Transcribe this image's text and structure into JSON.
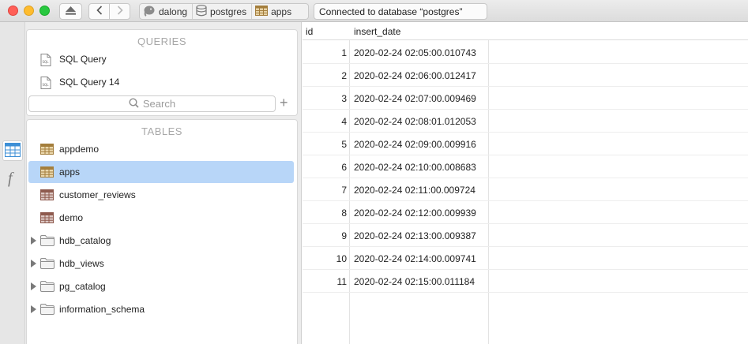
{
  "toolbar": {
    "breadcrumbs": [
      "dalong",
      "postgres",
      "apps"
    ],
    "status": "Connected to database “postgres”"
  },
  "sidebar": {
    "queries_title": "QUERIES",
    "queries": [
      {
        "label": "SQL Query"
      },
      {
        "label": "SQL Query 14"
      }
    ],
    "search_placeholder": "Search",
    "tables_title": "TABLES",
    "tables": [
      {
        "label": "appdemo",
        "kind": "table"
      },
      {
        "label": "apps",
        "kind": "table",
        "selected": true
      },
      {
        "label": "customer_reviews",
        "kind": "table"
      },
      {
        "label": "demo",
        "kind": "table"
      },
      {
        "label": "hdb_catalog",
        "kind": "schema"
      },
      {
        "label": "hdb_views",
        "kind": "schema"
      },
      {
        "label": "pg_catalog",
        "kind": "schema"
      },
      {
        "label": "information_schema",
        "kind": "schema"
      }
    ]
  },
  "grid": {
    "columns": [
      "id",
      "insert_date"
    ],
    "rows": [
      {
        "id": "1",
        "insert_date": "2020-02-24 02:05:00.010743"
      },
      {
        "id": "2",
        "insert_date": "2020-02-24 02:06:00.012417"
      },
      {
        "id": "3",
        "insert_date": "2020-02-24 02:07:00.009469"
      },
      {
        "id": "4",
        "insert_date": "2020-02-24 02:08:01.012053"
      },
      {
        "id": "5",
        "insert_date": "2020-02-24 02:09:00.009916"
      },
      {
        "id": "6",
        "insert_date": "2020-02-24 02:10:00.008683"
      },
      {
        "id": "7",
        "insert_date": "2020-02-24 02:11:00.009724"
      },
      {
        "id": "8",
        "insert_date": "2020-02-24 02:12:00.009939"
      },
      {
        "id": "9",
        "insert_date": "2020-02-24 02:13:00.009387"
      },
      {
        "id": "10",
        "insert_date": "2020-02-24 02:14:00.009741"
      },
      {
        "id": "11",
        "insert_date": "2020-02-24 02:15:00.011184"
      }
    ]
  },
  "icons": {
    "rail": [
      "table-grid-icon",
      "function-icon"
    ],
    "query": "sql-document-icon",
    "table": "table-icon",
    "schema": "folder-icon"
  },
  "colors": {
    "selection": "#b8d6f8",
    "table_icon": "#b08a4a"
  }
}
